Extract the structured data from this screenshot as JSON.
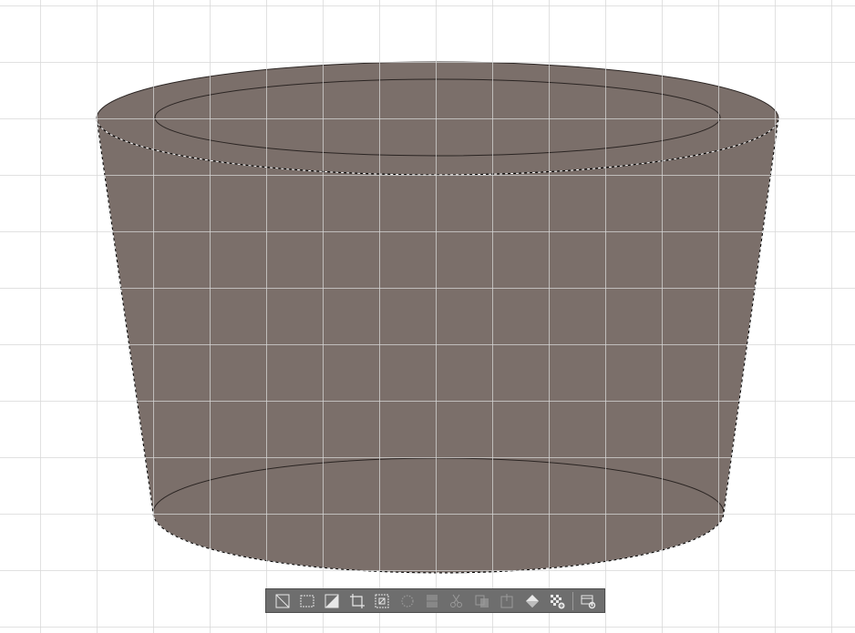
{
  "canvas": {
    "background": "#ffffff",
    "grid_color": "#d7d7d7",
    "grid_visible": true
  },
  "shape": {
    "type": "truncated-cone",
    "fill": "#7b6f6a",
    "stroke": "#2a2422",
    "selection_marquee": "marching-ants"
  },
  "selection_toolbar": {
    "background": "#6e6e6e",
    "icon_color": "#e8e8e8",
    "disabled_icon_color": "#9a9a9a",
    "buttons": [
      {
        "icon": "deselect-icon",
        "enabled": true
      },
      {
        "icon": "select-all-icon",
        "enabled": true
      },
      {
        "icon": "invert-selection-icon",
        "enabled": true
      },
      {
        "icon": "crop-icon",
        "enabled": true
      },
      {
        "icon": "transform-selection-icon",
        "enabled": true
      },
      {
        "icon": "feather-selection-icon",
        "enabled": false
      },
      {
        "icon": "selection-area-icon",
        "enabled": false
      },
      {
        "icon": "cut-icon",
        "enabled": false
      },
      {
        "icon": "copy-icon",
        "enabled": false
      },
      {
        "icon": "paste-icon",
        "enabled": false
      },
      {
        "icon": "fill-icon",
        "enabled": true
      },
      {
        "icon": "quick-mask-icon",
        "enabled": true
      },
      {
        "icon": "toolbar-settings-icon",
        "enabled": true
      }
    ]
  }
}
